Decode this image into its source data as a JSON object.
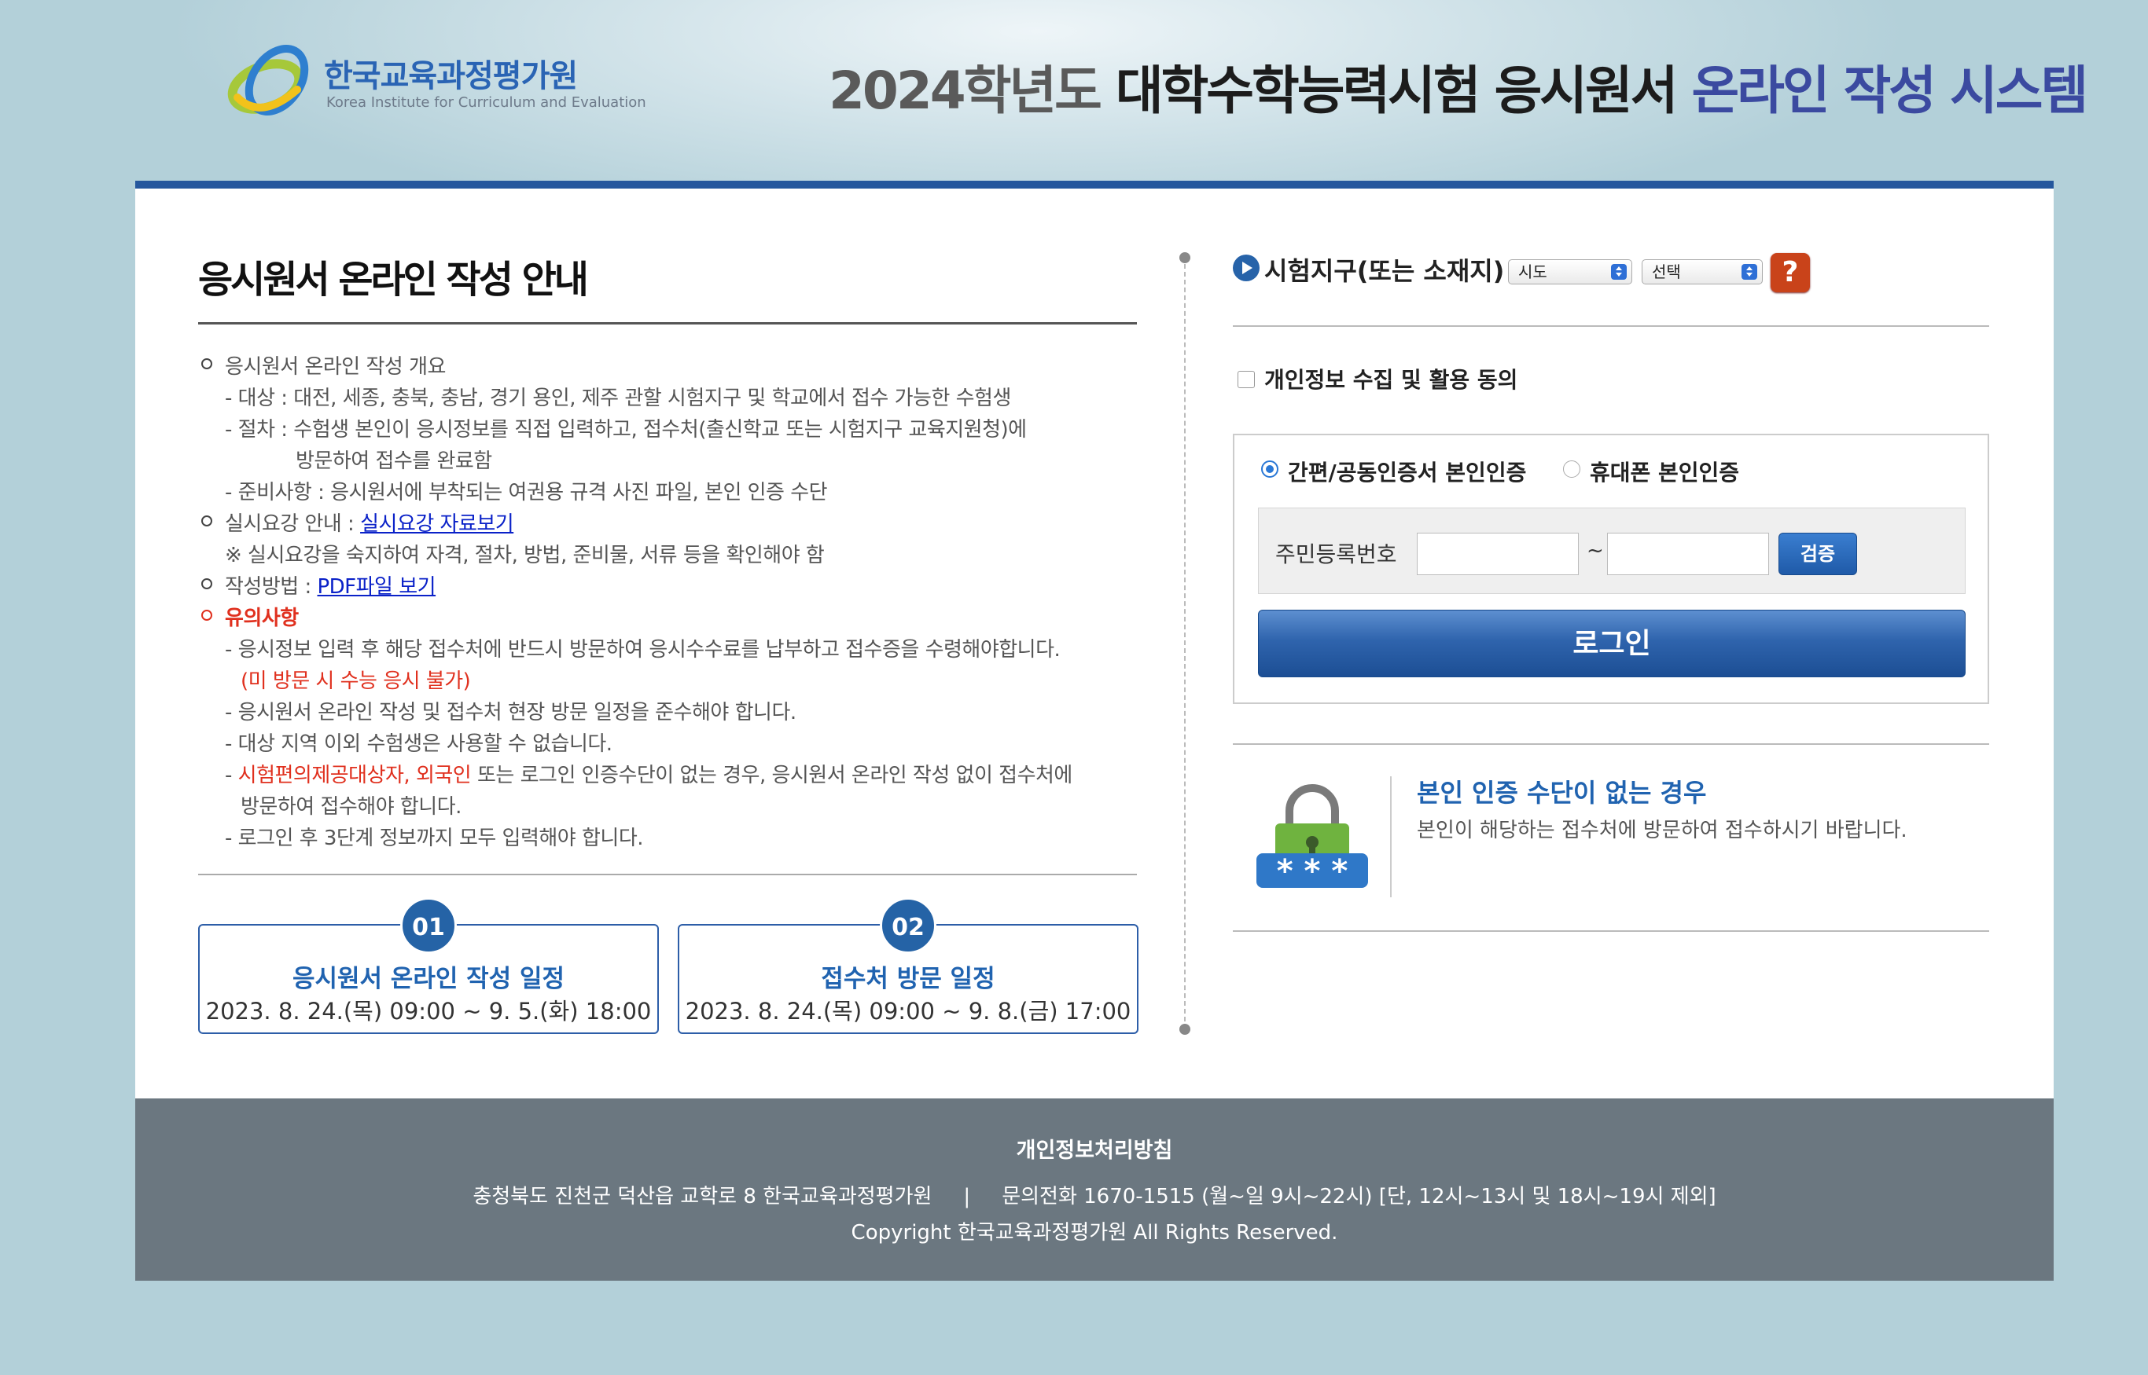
{
  "header": {
    "logo_ko": "한국교육과정평가원",
    "logo_en": "Korea Institute for Curriculum and Evaluation",
    "title_year": "2024학년도",
    "title_main": "대학수학능력시험 응시원서",
    "title_sys": "온라인 작성 시스템"
  },
  "guide": {
    "title": "응시원서 온라인 작성 안내",
    "l1": "응시원서 온라인 작성 개요",
    "l2": "- 대상 : 대전, 세종, 충북, 충남, 경기 용인, 제주 관할 시험지구 및 학교에서 접수 가능한 수험생",
    "l3": "- 절차 : 수험생 본인이 응시정보를 직접 입력하고, 접수처(출신학교 또는 시험지구 교육지원청)에",
    "l4": "방문하여 접수를 완료함",
    "l5": "- 준비사항 : 응시원서에 부착되는 여권용 규격 사진 파일, 본인 인증 수단",
    "l6_prefix": "실시요강 안내 : ",
    "l6_link": "실시요강 자료보기",
    "l7": "※ 실시요강을 숙지하여 자격, 절차, 방법, 준비물, 서류 등을 확인해야 함",
    "l8_prefix": "작성방법 : ",
    "l8_link": "PDF파일 보기",
    "l9": "유의사항",
    "l10": "- 응시정보 입력 후 해당 접수처에 반드시 방문하여 응시수수료를 납부하고 접수증을 수령해야합니다.",
    "l11": "(미 방문 시 수능 응시 불가)",
    "l12": "- 응시원서 온라인 작성 및 접수처 현장 방문 일정을 준수해야 합니다.",
    "l13": "- 대상 지역 이외 수험생은 사용할 수 없습니다.",
    "l14_dash": "- ",
    "l14_red": "시험편의제공대상자, 외국인",
    "l14_rest": " 또는 로그인 인증수단이 없는 경우, 응시원서 온라인 작성 없이 접수처에",
    "l15": "방문하여 접수해야 합니다.",
    "l16": "- 로그인 후 3단계 정보까지 모두 입력해야 합니다."
  },
  "schedules": [
    {
      "num": "01",
      "title": "응시원서 온라인 작성 일정",
      "date": "2023. 8. 24.(목) 09:00 ~ 9. 5.(화) 18:00"
    },
    {
      "num": "02",
      "title": "접수처 방문 일정",
      "date": "2023. 8. 24.(목) 09:00 ~ 9. 8.(금) 17:00"
    }
  ],
  "login": {
    "region_label": "시험지구(또는 소재지)",
    "sido_value": "시도",
    "district_value": "선택",
    "help_label": "?",
    "consent_label": "개인정보 수집 및 활용 동의",
    "consent_checked": false,
    "radio1": "간편/공동인증서 본인인증",
    "radio2": "휴대폰 본인인증",
    "id_label": "주민등록번호",
    "id_sep": "~",
    "id_front": "",
    "id_back": "",
    "verify_label": "검증",
    "login_label": "로그인",
    "noauth_title": "본인 인증 수단이 없는 경우",
    "noauth_desc": "본인이 해당하는 접수처에 방문하여 접수하시기 바랍니다.",
    "lock_code": "* * *"
  },
  "footer": {
    "privacy": "개인정보처리방침",
    "address": "충청북도 진천군 덕산읍 교학로 8 한국교육과정평가원",
    "separator": "|",
    "contact": "문의전화 1670-1515 (월~일 9시~22시) [단, 12시~13시 및 18시~19시 제외]",
    "copyright": "Copyright 한국교육과정평가원 All Rights Reserved."
  },
  "colors": {
    "brand_blue": "#25579d",
    "accent_red": "#e0301e",
    "link_blue": "#0a21c8",
    "footer_gray": "#6b7780",
    "background": "#b3d0d9"
  }
}
